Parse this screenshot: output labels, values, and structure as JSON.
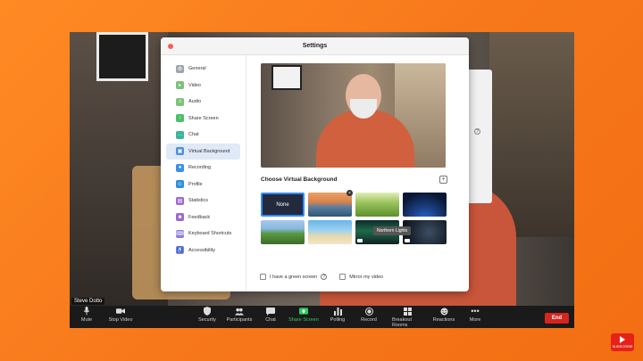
{
  "window": {
    "participant_name": "Steve Dotto"
  },
  "toolbar": {
    "items": [
      {
        "label": "Mute",
        "icon": "microphone-icon"
      },
      {
        "label": "Stop Video",
        "icon": "video-camera-icon"
      },
      {
        "label": "Security",
        "icon": "shield-icon"
      },
      {
        "label": "Participants",
        "icon": "people-icon"
      },
      {
        "label": "Chat",
        "icon": "chat-bubble-icon"
      },
      {
        "label": "Share Screen",
        "icon": "share-screen-icon"
      },
      {
        "label": "Polling",
        "icon": "bar-chart-icon"
      },
      {
        "label": "Record",
        "icon": "record-icon"
      },
      {
        "label": "Breakout Rooms",
        "icon": "grid-icon"
      },
      {
        "label": "Reactions",
        "icon": "smiley-icon"
      },
      {
        "label": "More",
        "icon": "more-dots-icon"
      }
    ],
    "end_label": "End",
    "share_color": "#2fcb63",
    "end_color": "#d6241f"
  },
  "settings": {
    "title": "Settings",
    "nav": [
      {
        "label": "General",
        "icon": "gear-icon",
        "color": "#a0a6ad"
      },
      {
        "label": "Video",
        "icon": "video-icon",
        "color": "#7dc27a"
      },
      {
        "label": "Audio",
        "icon": "headphones-icon",
        "color": "#7dc27a"
      },
      {
        "label": "Share Screen",
        "icon": "share-screen-icon",
        "color": "#4cbf6b"
      },
      {
        "label": "Chat",
        "icon": "chat-icon",
        "color": "#39b59a"
      },
      {
        "label": "Virtual Background",
        "icon": "virtual-background-icon",
        "color": "#4e8fdd"
      },
      {
        "label": "Recording",
        "icon": "record-icon",
        "color": "#3a91e8"
      },
      {
        "label": "Profile",
        "icon": "profile-icon",
        "color": "#2e8fd8"
      },
      {
        "label": "Statistics",
        "icon": "statistics-icon",
        "color": "#9a6ad2"
      },
      {
        "label": "Feedback",
        "icon": "feedback-icon",
        "color": "#9a6ad2"
      },
      {
        "label": "Keyboard Shortcuts",
        "icon": "keyboard-icon",
        "color": "#8a7fd6"
      },
      {
        "label": "Accessibility",
        "icon": "accessibility-icon",
        "color": "#8a7fd6"
      }
    ],
    "active_index": 5,
    "section_title": "Choose Virtual Background",
    "backgrounds": [
      {
        "label": "None",
        "selected": true
      },
      {
        "label": ""
      },
      {
        "label": ""
      },
      {
        "label": ""
      },
      {
        "label": ""
      },
      {
        "label": ""
      },
      {
        "label": ""
      },
      {
        "label": ""
      }
    ],
    "tooltip": "Northern Lights",
    "green_screen_label": "I have a green screen",
    "mirror_label": "Mirror my video",
    "accent_color": "#2d8cff"
  },
  "subscribe": "SUBSCRIBE"
}
